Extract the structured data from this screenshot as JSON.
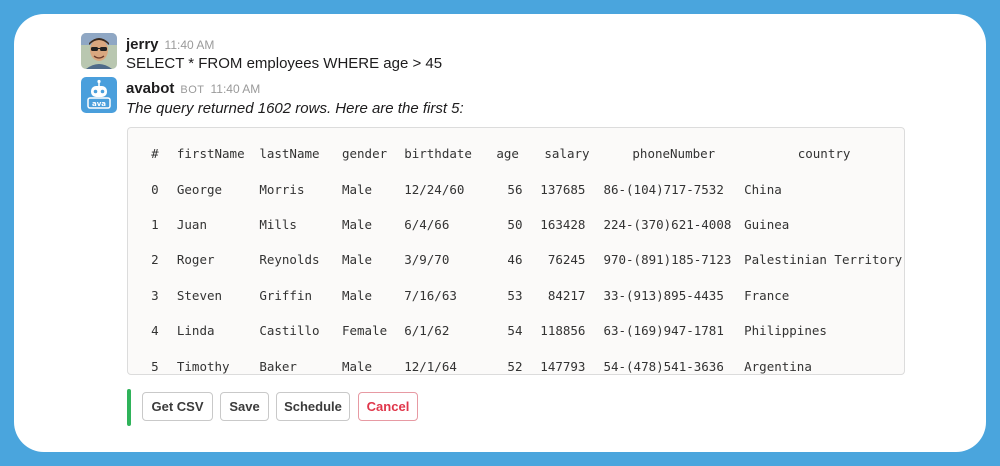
{
  "messages": [
    {
      "user": "jerry",
      "time": "11:40 AM",
      "text": "SELECT * FROM employees WHERE age > 45",
      "avatar_icon": "jerry-avatar"
    },
    {
      "user": "avabot",
      "badge": "BOT",
      "time": "11:40 AM",
      "text": "The query returned 1602 rows. Here are the first 5:",
      "avatar_icon": "robot-icon",
      "avatar_label": "ava"
    }
  ],
  "table": {
    "headers": [
      "#",
      "firstName",
      "lastName",
      "gender",
      "birthdate",
      "age",
      "salary",
      "phoneNumber",
      "country"
    ],
    "rows": [
      [
        "0",
        "George",
        "Morris",
        "Male",
        "12/24/60",
        "56",
        "137685",
        "86-(104)717-7532",
        "China"
      ],
      [
        "1",
        "Juan",
        "Mills",
        "Male",
        "6/4/66",
        "50",
        "163428",
        "224-(370)621-4008",
        "Guinea"
      ],
      [
        "2",
        "Roger",
        "Reynolds",
        "Male",
        "3/9/70",
        "46",
        "76245",
        "970-(891)185-7123",
        "Palestinian Territory"
      ],
      [
        "3",
        "Steven",
        "Griffin",
        "Male",
        "7/16/63",
        "53",
        "84217",
        "33-(913)895-4435",
        "France"
      ],
      [
        "4",
        "Linda",
        "Castillo",
        "Female",
        "6/1/62",
        "54",
        "118856",
        "63-(169)947-1781",
        "Philippines"
      ],
      [
        "5",
        "Timothy",
        "Baker",
        "Male",
        "12/1/64",
        "52",
        "147793",
        "54-(478)541-3636",
        "Argentina"
      ]
    ]
  },
  "actions": {
    "csv": "Get CSV",
    "save": "Save",
    "schedule": "Schedule",
    "cancel": "Cancel"
  },
  "colors": {
    "background": "#4aa5dd",
    "accent_bar": "#2fb35a",
    "cancel": "#e0364a",
    "bot_avatar": "#4a9fdc"
  }
}
